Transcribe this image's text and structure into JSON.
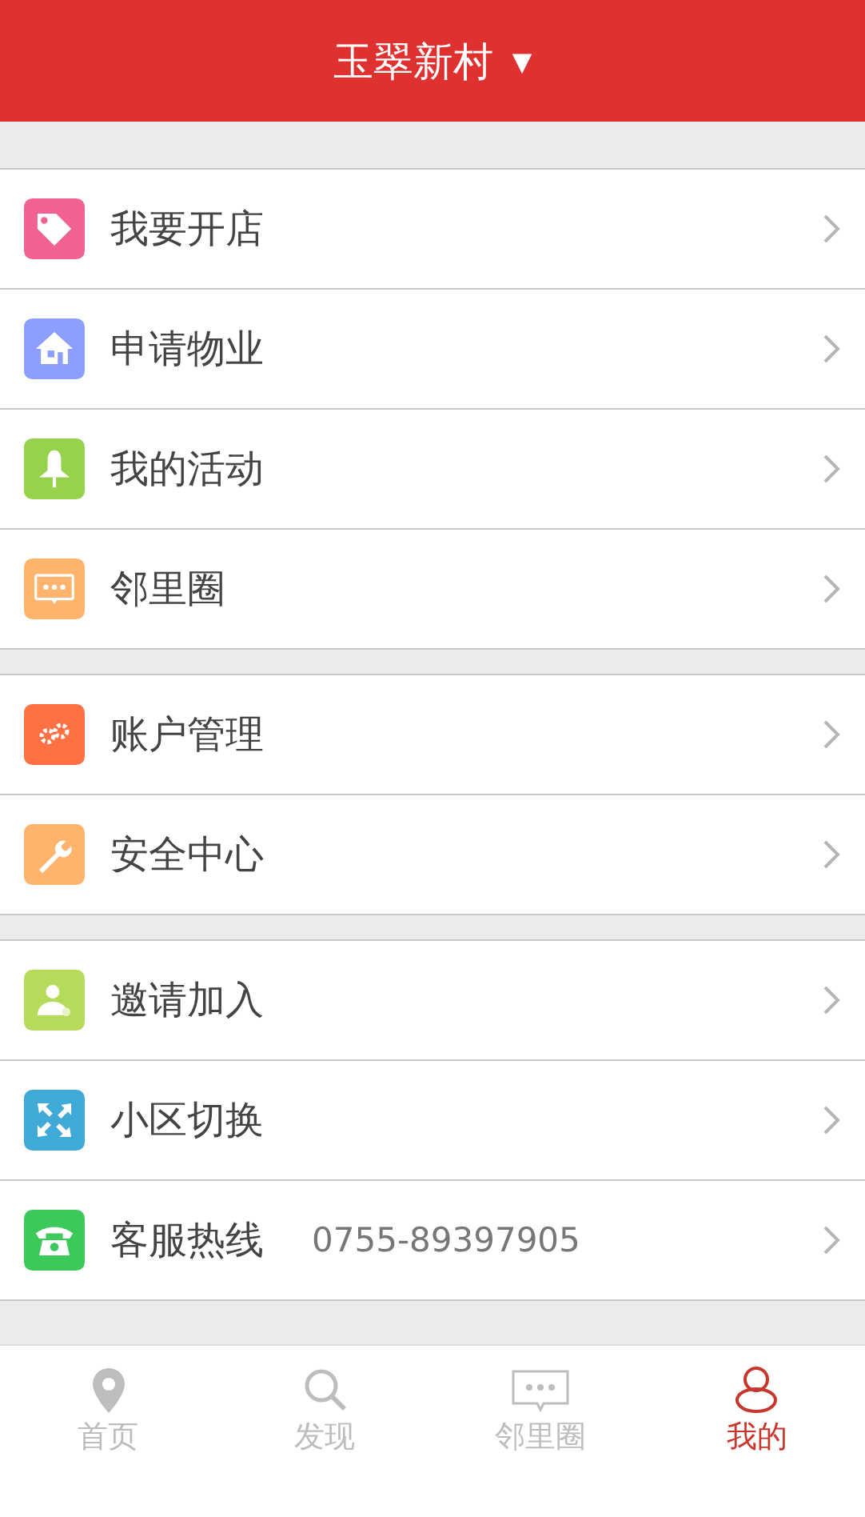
{
  "header": {
    "title": "玉翠新村",
    "dropdown": "▼"
  },
  "groups": [
    {
      "items": [
        {
          "label": "我要开店",
          "color": "#f06292"
        },
        {
          "label": "申请物业",
          "color": "#8c9eff"
        },
        {
          "label": "我的活动",
          "color": "#96d24b"
        },
        {
          "label": "邻里圈",
          "color": "#ffb46e"
        }
      ]
    },
    {
      "items": [
        {
          "label": "账户管理",
          "color": "#ff7043"
        },
        {
          "label": "安全中心",
          "color": "#ffb46e"
        }
      ]
    },
    {
      "items": [
        {
          "label": "邀请加入",
          "color": "#b4dc5a"
        },
        {
          "label": "小区切换",
          "color": "#3fa9d8"
        },
        {
          "label": "客服热线",
          "color": "#3dc85a",
          "value": "0755-89397905"
        }
      ]
    }
  ],
  "tabs": [
    {
      "label": "首页",
      "selected": false
    },
    {
      "label": "发现",
      "selected": false
    },
    {
      "label": "邻里圈",
      "selected": false
    },
    {
      "label": "我的",
      "selected": true
    }
  ]
}
